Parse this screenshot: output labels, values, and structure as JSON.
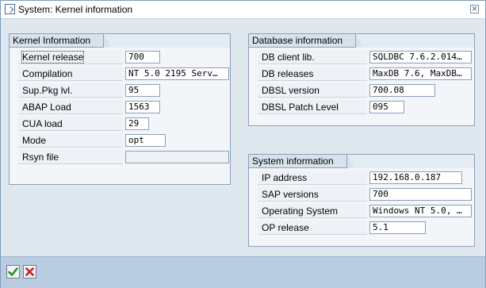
{
  "window": {
    "title": "System: Kernel information"
  },
  "kernel": {
    "heading": "Kernel Information",
    "rows": [
      {
        "label": "Kernel release",
        "value": "700"
      },
      {
        "label": "Compilation",
        "value": "NT 5.0 2195 Serv…"
      },
      {
        "label": "Sup.Pkg lvl.",
        "value": "95"
      },
      {
        "label": "ABAP Load",
        "value": "1563"
      },
      {
        "label": "CUA load",
        "value": "29"
      },
      {
        "label": "Mode",
        "value": "opt"
      },
      {
        "label": "Rsyn file",
        "value": ""
      }
    ]
  },
  "database": {
    "heading": "Database information",
    "rows": [
      {
        "label": "DB client lib.",
        "value": "SQLDBC 7.6.2.014…"
      },
      {
        "label": "DB releases",
        "value": "MaxDB 7.6, MaxDB…"
      },
      {
        "label": "DBSL version",
        "value": "700.08"
      },
      {
        "label": "DBSL Patch Level",
        "value": "095"
      }
    ]
  },
  "system": {
    "heading": "System information",
    "rows": [
      {
        "label": "IP address",
        "value": "192.168.0.187"
      },
      {
        "label": "SAP versions",
        "value": "700"
      },
      {
        "label": "Operating System",
        "value": "Windows NT 5.0, …"
      },
      {
        "label": "OP release",
        "value": "5.1"
      }
    ]
  },
  "footer": {
    "ok_icon": "checkmark-icon",
    "cancel_icon": "cancel-icon",
    "ok_color": "#1a8a1a",
    "cancel_color": "#c81e1e"
  }
}
